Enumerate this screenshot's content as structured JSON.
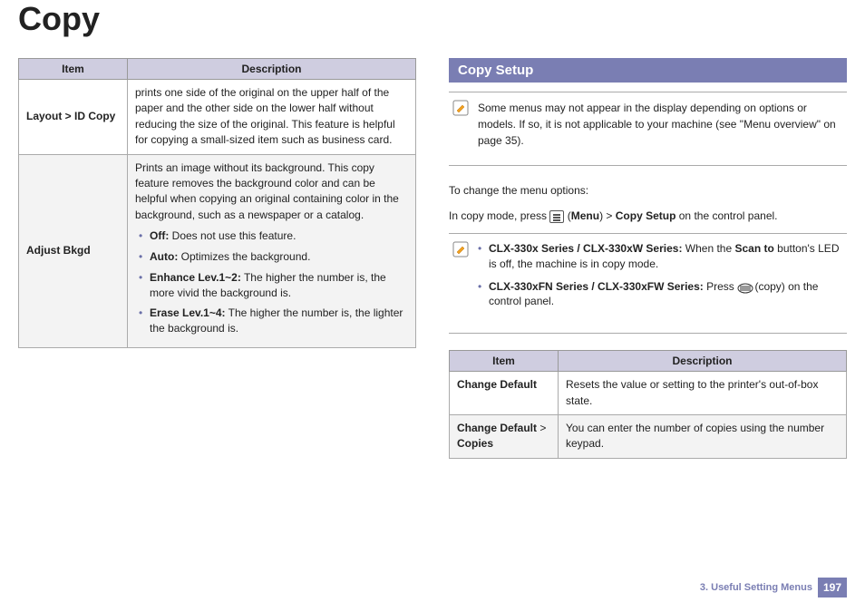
{
  "title": "Copy",
  "left_table": {
    "headers": {
      "item": "Item",
      "desc": "Description"
    },
    "rows": [
      {
        "item": "Layout > ID Copy",
        "desc": "prints one side of the original on the upper half of the paper and the other side on the lower half without reducing the size of the original. This feature is helpful for copying a small-sized item such as business card."
      },
      {
        "item": "Adjust Bkgd",
        "desc_intro": "Prints an image without its background. This copy feature removes the background color and can be helpful when copying an original containing color in the background, such as a newspaper or a catalog.",
        "options": [
          {
            "label": "Off:",
            "text": " Does not use this feature."
          },
          {
            "label": "Auto:",
            "text": " Optimizes the background."
          },
          {
            "label": "Enhance Lev.1~2:",
            "text": " The higher the number is, the more vivid the background is."
          },
          {
            "label": "Erase Lev.1~4:",
            "text": " The higher the number is, the lighter the background is."
          }
        ]
      }
    ]
  },
  "right": {
    "section_title": "Copy Setup",
    "note1": "Some menus may not appear in the display depending on options or models. If so, it is not applicable to your machine (see \"Menu overview\" on page 35).",
    "intro1": "To change the menu options:",
    "intro2_a": "In copy mode, press ",
    "intro2_b": " (",
    "intro2_menu": "Menu",
    "intro2_c": ") > ",
    "intro2_copysetup": "Copy Setup",
    "intro2_d": " on the control panel.",
    "note2_items": [
      {
        "label": "CLX-330x Series / CLX-330xW Series:",
        "text_a": " When the ",
        "text_bold": "Scan to",
        "text_b": " button's LED is off, the machine is in copy mode."
      },
      {
        "label": "CLX-330xFN Series / CLX-330xFW Series:",
        "text_a": " Press ",
        "has_icon": true,
        "text_b": " (copy) on the control panel."
      }
    ],
    "table": {
      "headers": {
        "item": "Item",
        "desc": "Description"
      },
      "rows": [
        {
          "item": "Change Default",
          "desc": "Resets the value or setting to the printer's out-of-box state."
        },
        {
          "item_a": "Change Default",
          "item_sep": " > ",
          "item_b": "Copies",
          "desc": "You can enter the number of copies using the number keypad."
        }
      ]
    }
  },
  "footer": {
    "chapter": "3.  Useful Setting Menus",
    "page": "197"
  }
}
